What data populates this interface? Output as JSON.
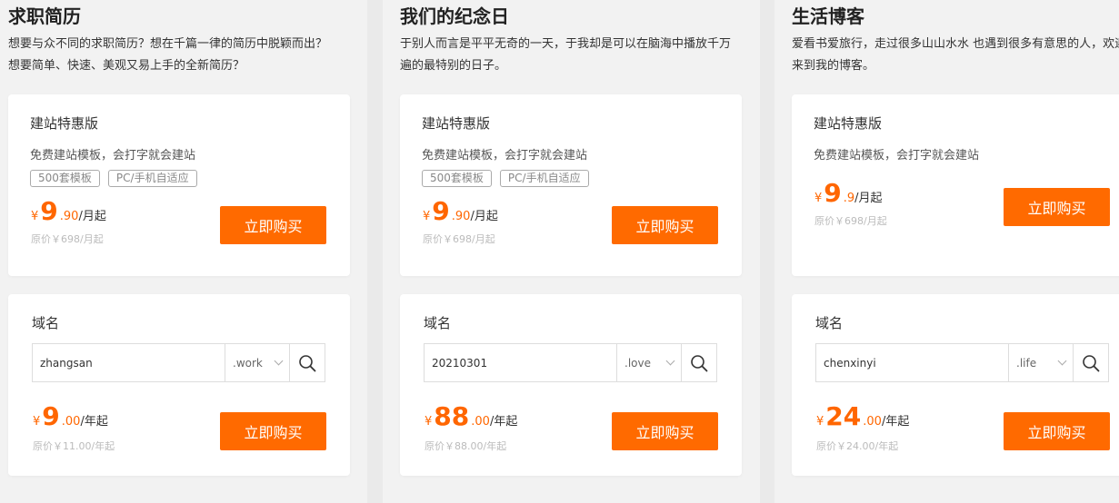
{
  "columns": [
    {
      "title": "求职简历",
      "description": "想要与众不同的求职简历？想在千篇一律的简历中脱颖而出？想要简单、快速、美观又易上手的全新简历？",
      "site_card": {
        "title": "建站特惠版",
        "subtitle": "免费建站模板，会打字就会建站",
        "tags": [
          "500套模板",
          "PC/手机自适应"
        ],
        "currency": "¥",
        "price_int": "9",
        "price_dec": ".90",
        "unit": "/月起",
        "original": "原价￥698/月起",
        "buy_label": "立即购买"
      },
      "domain_card": {
        "title": "域名",
        "input_value": "zhangsan",
        "suffix": ".work",
        "currency": "¥",
        "price_int": "9",
        "price_dec": ".00",
        "unit": "/年起",
        "original": "原价￥11.00/年起",
        "buy_label": "立即购买"
      }
    },
    {
      "title": "我们的纪念日",
      "description": "于别人而言是平平无奇的一天，于我却是可以在脑海中播放千万遍的最特别的日子。",
      "site_card": {
        "title": "建站特惠版",
        "subtitle": "免费建站模板，会打字就会建站",
        "tags": [
          "500套模板",
          "PC/手机自适应"
        ],
        "currency": "¥",
        "price_int": "9",
        "price_dec": ".90",
        "unit": "/月起",
        "original": "原价￥698/月起",
        "buy_label": "立即购买"
      },
      "domain_card": {
        "title": "域名",
        "input_value": "20210301",
        "suffix": ".love",
        "currency": "¥",
        "price_int": "88",
        "price_dec": ".00",
        "unit": "/年起",
        "original": "原价￥88.00/年起",
        "buy_label": "立即购买"
      }
    },
    {
      "title": "生活博客",
      "description": "爱看书爱旅行，走过很多山山水水 也遇到很多有意思的人，欢迎来到我的博客。",
      "site_card": {
        "title": "建站特惠版",
        "subtitle": "免费建站模板，会打字就会建站",
        "tags": [],
        "currency": "¥",
        "price_int": "9",
        "price_dec": ".9",
        "unit": "/月起",
        "original": "原价￥698/月起",
        "buy_label": "立即购买"
      },
      "domain_card": {
        "title": "域名",
        "input_value": "chenxinyi",
        "suffix": ".life",
        "currency": "¥",
        "price_int": "24",
        "price_dec": ".00",
        "unit": "/年起",
        "original": "原价￥24.00/年起",
        "buy_label": "立即购买"
      }
    }
  ],
  "icons": {
    "search": "search-icon",
    "chevron": "chevron-down-icon"
  },
  "colors": {
    "accent": "#ff6a00",
    "price": "#ff6600",
    "background": "#f2f2f2",
    "card": "#ffffff"
  }
}
